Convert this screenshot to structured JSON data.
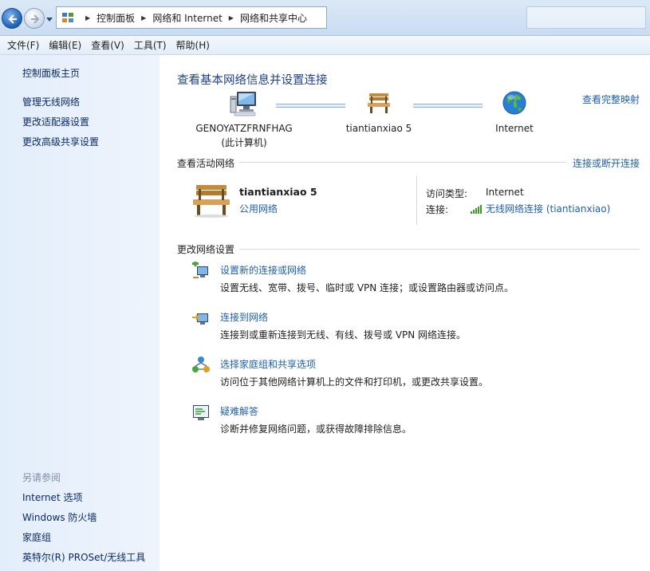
{
  "address": {
    "crumbs": [
      "控制面板",
      "网络和 Internet",
      "网络和共享中心"
    ],
    "sep_glyph": "▶"
  },
  "menu": [
    "文件(F)",
    "编辑(E)",
    "查看(V)",
    "工具(T)",
    "帮助(H)"
  ],
  "sidebar": {
    "home": "控制面板主页",
    "tasks": [
      "管理无线网络",
      "更改适配器设置",
      "更改高级共享设置"
    ],
    "see_also_title": "另请参阅",
    "see_also": [
      "Internet 选项",
      "Windows 防火墙",
      "家庭组",
      "英特尔(R) PROSet/无线工具"
    ]
  },
  "main": {
    "title": "查看基本网络信息并设置连接",
    "view_full_map": "查看完整映射",
    "map": {
      "computer_name": "GENOYATZFRNFHAG",
      "computer_sub": "(此计算机)",
      "network": "tiantianxiao  5",
      "internet": "Internet"
    },
    "active_head": "查看活动网络",
    "connect_disconnect": "连接或断开连接",
    "active": {
      "name": "tiantianxiao  5",
      "type": "公用网络",
      "access_label": "访问类型:",
      "access_value": "Internet",
      "conn_label": "连接:",
      "conn_value": "无线网络连接 (tiantianxiao)"
    },
    "change_head": "更改网络设置",
    "tasks": [
      {
        "title": "设置新的连接或网络",
        "desc": "设置无线、宽带、拨号、临时或 VPN 连接；或设置路由器或访问点。",
        "icon": "new-connection-icon"
      },
      {
        "title": "连接到网络",
        "desc": "连接到或重新连接到无线、有线、拨号或 VPN 网络连接。",
        "icon": "connect-network-icon"
      },
      {
        "title": "选择家庭组和共享选项",
        "desc": "访问位于其他网络计算机上的文件和打印机，或更改共享设置。",
        "icon": "homegroup-icon"
      },
      {
        "title": "疑难解答",
        "desc": "诊断并修复网络问题，或获得故障排除信息。",
        "icon": "troubleshoot-icon"
      }
    ]
  },
  "colors": {
    "link": "#1f5fb2",
    "title": "#1e3f8c",
    "sidebar_bg": "#e3eefb",
    "signal": "#3a9a2a"
  }
}
